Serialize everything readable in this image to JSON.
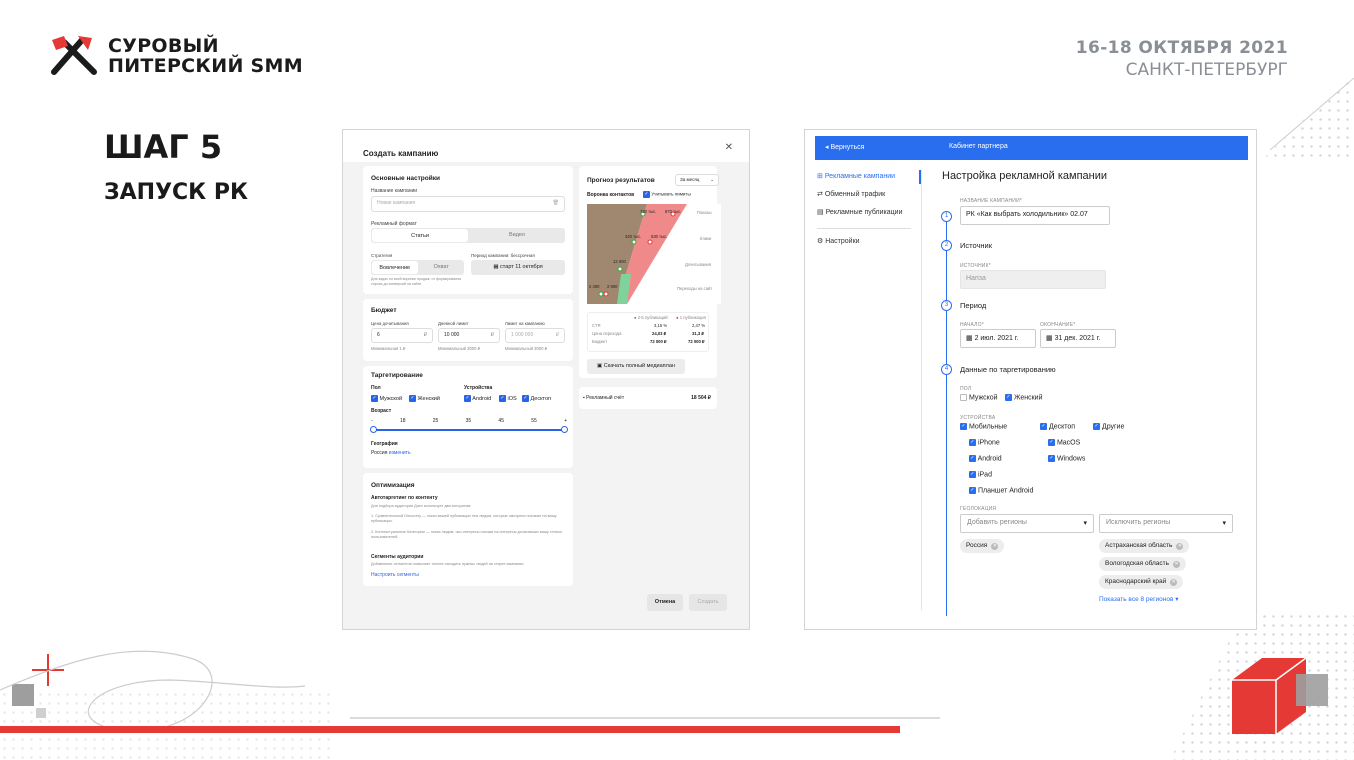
{
  "logo": {
    "line1": "СУРОВЫЙ",
    "line2": "ПИТЕРСКИЙ SMM"
  },
  "event": {
    "dates": "16-18 ОКТЯБРЯ 2021",
    "city": "САНКТ-ПЕТЕРБУРГ"
  },
  "step": {
    "title": "ШАГ 5",
    "subtitle": "ЗАПУСК РК"
  },
  "left_screen": {
    "title": "Создать кампанию",
    "basic": {
      "heading": "Основные настройки",
      "name_label": "Название кампании",
      "name_placeholder": "Новая кампания",
      "format_label": "Рекламный формат",
      "format_opts": [
        "Статьи",
        "Видео"
      ],
      "strategy_label": "Стратегия",
      "strategy_opts": [
        "Вовлечение",
        "Охват"
      ],
      "strategy_hint": "Для задач по всей воронке продаж: от формирования спроса до конверсий на сайте",
      "period_label": "Период кампании: бессрочная",
      "period_value": "старт 11 октября"
    },
    "budget": {
      "heading": "Бюджет",
      "price_label": "Цена дочитывания",
      "price_value": "6",
      "price_min": "Минимальная 1 ₽",
      "daily_label": "Дневной лимит",
      "daily_value": "10 000",
      "daily_min": "Минимальный 3000 ₽",
      "campaign_label": "Лимит на кампанию",
      "campaign_value": "1 000 000",
      "campaign_min": "Минимальный 3000 ₽",
      "currency": "₽"
    },
    "targeting": {
      "heading": "Таргетирование",
      "gender_label": "Пол",
      "genders": [
        "Мужской",
        "Женский"
      ],
      "devices_label": "Устройства",
      "devices": [
        "Android",
        "iOS",
        "Десктоп"
      ],
      "age_label": "Возраст",
      "age_ticks": [
        "-",
        "18",
        "25",
        "35",
        "45",
        "55",
        "+"
      ],
      "geo_label": "География",
      "geo_value": "Россия",
      "geo_change": "изменить"
    },
    "optimization": {
      "heading": "Оптимизация",
      "auto_heading": "Автотаргетинг по контенту",
      "auto_text1": "Для подбора аудитории Дзен использует два алгоритма:",
      "auto_text2": "1. Сравнительный Discovery — показ вашей публикации тем людям, которые смотрели похожие на вашу публикации.",
      "auto_text3": "2. Контекстуальные Категории — показ людям, чьи интересы похожи на интересы дочитавших вашу статью пользователей.",
      "seg_heading": "Сегменты аудитории",
      "seg_text": "Добавление сегментов позволяет точнее находить нужных людей на старте кампании",
      "seg_link": "Настроить сегменты"
    },
    "forecast": {
      "heading": "Прогноз результатов",
      "period": "За месяц",
      "funnel_label": "Воронка контактов",
      "account_label": "Учитывать лимиты",
      "chart_labels": [
        "730 тыс.",
        "870 тыс.",
        "Показы",
        "420 тыс.",
        "530 тыс.",
        "Клики",
        "12 000",
        "Дочитывания",
        "2 300",
        "2 900",
        "Переходы на сайт"
      ],
      "legend": [
        "2-5 публикаций",
        "1 публикация"
      ],
      "rows": [
        {
          "k": "CTR",
          "a": "3,15 %",
          "b": "2,47 %"
        },
        {
          "k": "Цена перехода",
          "a": "24,03 ₽",
          "b": "31,3 ₽"
        },
        {
          "k": "Бюджет",
          "a": "72 000 ₽",
          "b": "72 000 ₽"
        }
      ],
      "download": "Скачать полный медиаплан"
    },
    "account": {
      "label": "Рекламный счёт",
      "value": "18 504 ₽"
    },
    "buttons": {
      "cancel": "Отмена",
      "create": "Создать"
    }
  },
  "right_screen": {
    "back": "Вернуться",
    "cabinet": "Кабинет партнера",
    "sidebar": [
      "Рекламные кампании",
      "Обменный трафик",
      "Рекламные публикации",
      "Настройки"
    ],
    "title": "Настройка рекламной кампании",
    "name_label": "НАЗВАНИЕ КАМПАНИИ*",
    "name_value": "РК «Как выбрать холодильник» 02.07",
    "source_heading": "Источник",
    "source_label": "ИСТОЧНИК*",
    "source_value": "Напза",
    "period_heading": "Период",
    "start_label": "НАЧАЛО*",
    "start_value": "2 июл. 2021 г.",
    "end_label": "ОКОНЧАНИЕ*",
    "end_value": "31 дек. 2021 г.",
    "target_heading": "Данные по таргетированию",
    "gender_label": "ПОЛ",
    "genders": [
      "Мужской",
      "Женский"
    ],
    "devices_label": "УСТРОЙСТВА",
    "dev_main": [
      "Мобильные",
      "Десктоп",
      "Другие"
    ],
    "dev_mobile": [
      "iPhone",
      "Android",
      "iPad",
      "Планшет Android"
    ],
    "dev_desktop": [
      "MacOS",
      "Windows"
    ],
    "geo_label": "ГЕОЛОКАЦИЯ",
    "geo_add": "Добавить регионы",
    "geo_exclude": "Исключить регионы",
    "geo_added": [
      "Россия"
    ],
    "geo_excluded": [
      "Астраханская область",
      "Вологодская область",
      "Краснодарский край"
    ],
    "show_all": "Показать все 8 регионов",
    "steps": [
      "1",
      "2",
      "3",
      "4"
    ]
  }
}
